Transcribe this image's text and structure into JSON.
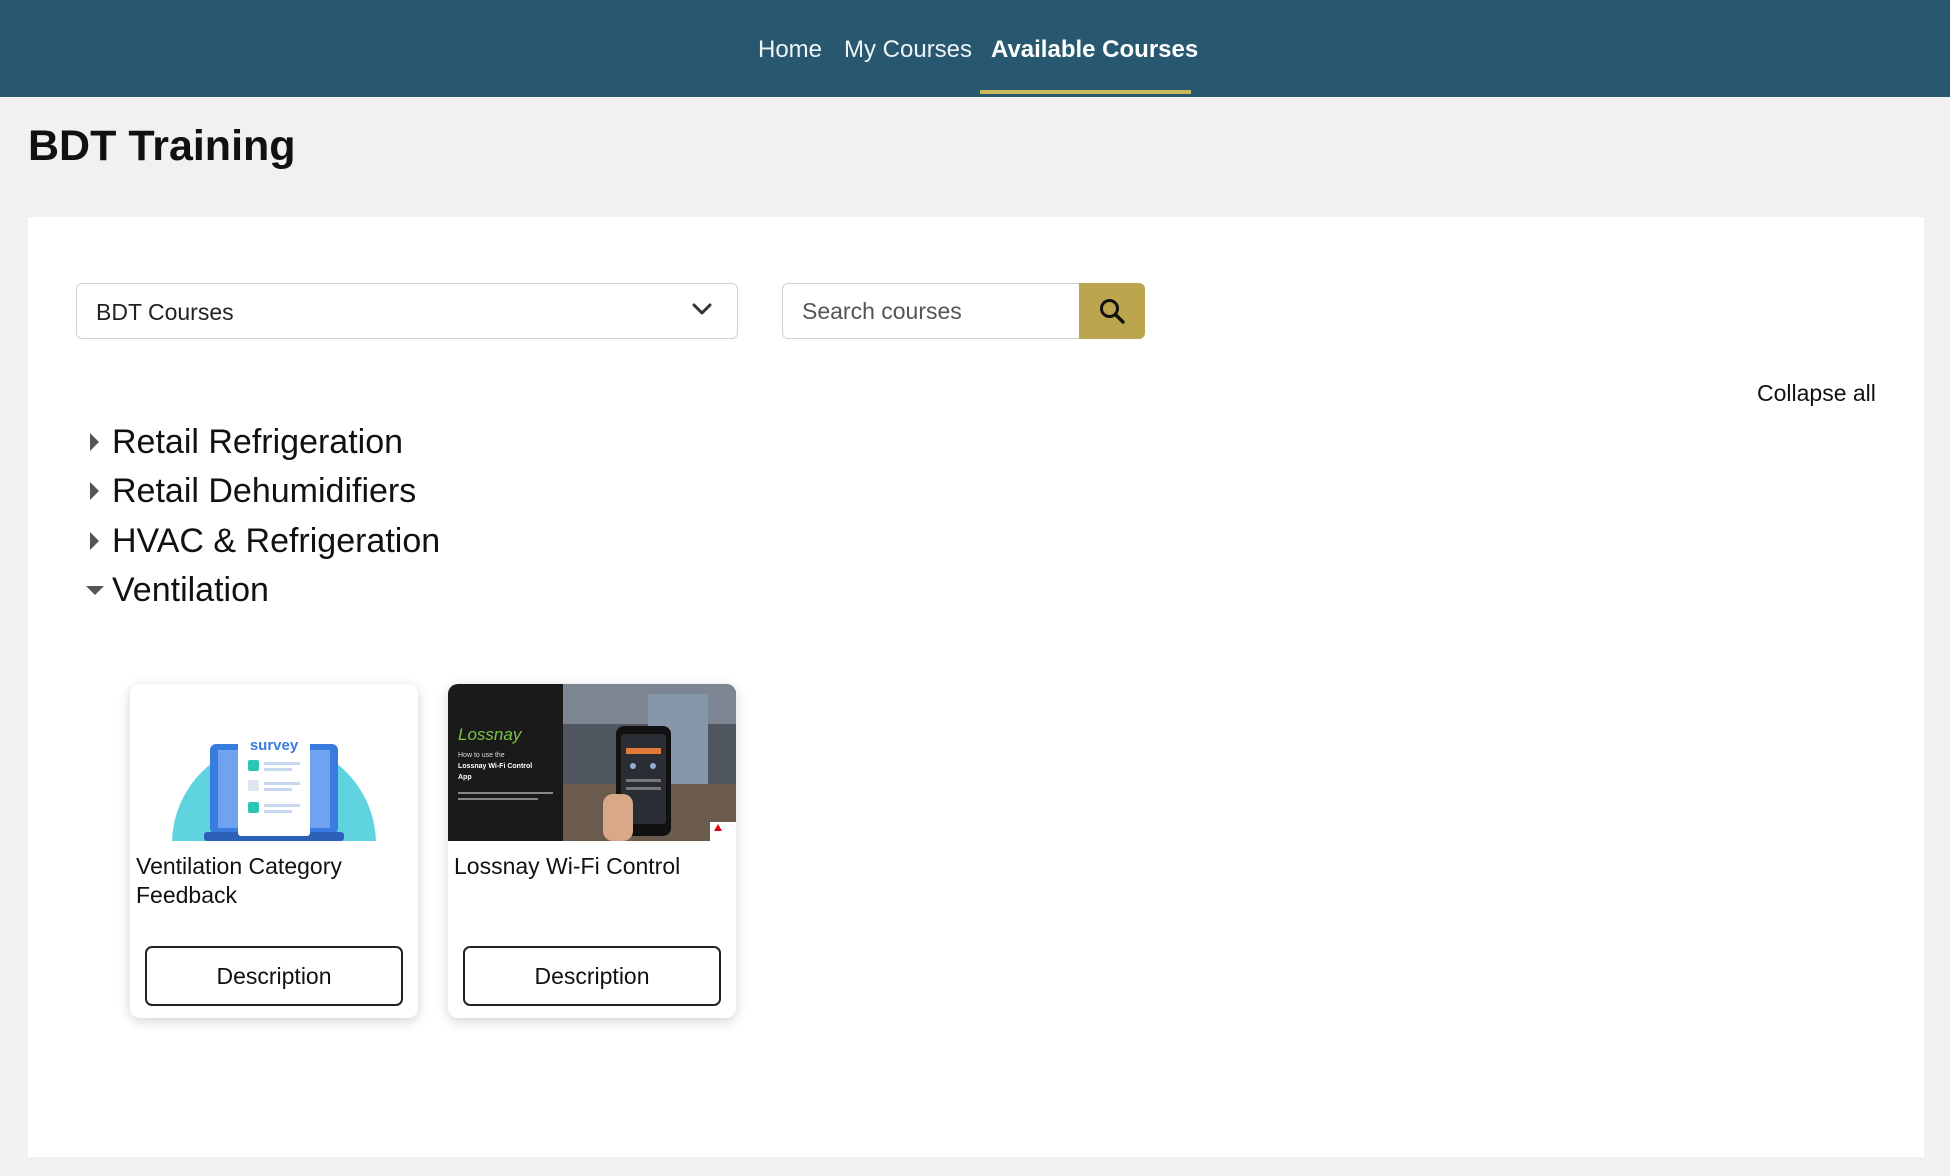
{
  "nav": {
    "items": [
      {
        "label": "Home",
        "active": false
      },
      {
        "label": "My Courses",
        "active": false
      },
      {
        "label": "Available Courses",
        "active": true
      }
    ],
    "accent_color": "#c7b95a",
    "background_color": "#27586f"
  },
  "page": {
    "title": "BDT Training"
  },
  "filters": {
    "category_select": {
      "value": "BDT Courses",
      "icon": "chevron-down-icon"
    },
    "search": {
      "placeholder": "Search courses",
      "icon": "search-icon",
      "button_color": "#bba64f"
    }
  },
  "collapse_all_label": "Collapse all",
  "categories": [
    {
      "label": "Retail Refrigeration",
      "expanded": false
    },
    {
      "label": "Retail Dehumidifiers",
      "expanded": false
    },
    {
      "label": "HVAC & Refrigeration",
      "expanded": false
    },
    {
      "label": "Ventilation",
      "expanded": true
    }
  ],
  "courses": [
    {
      "title": "Ventilation Category Feedback",
      "button_label": "Description",
      "image": {
        "word": "survey",
        "icon": "survey-laptop-image"
      }
    },
    {
      "title": "Lossnay Wi-Fi Control",
      "button_label": "Description",
      "image": {
        "brand": "Lossnay",
        "line1": "How to use the",
        "line2": "Lossnay Wi-Fi Control",
        "line3": "App",
        "icon": "lossnay-app-promo-image"
      }
    }
  ]
}
